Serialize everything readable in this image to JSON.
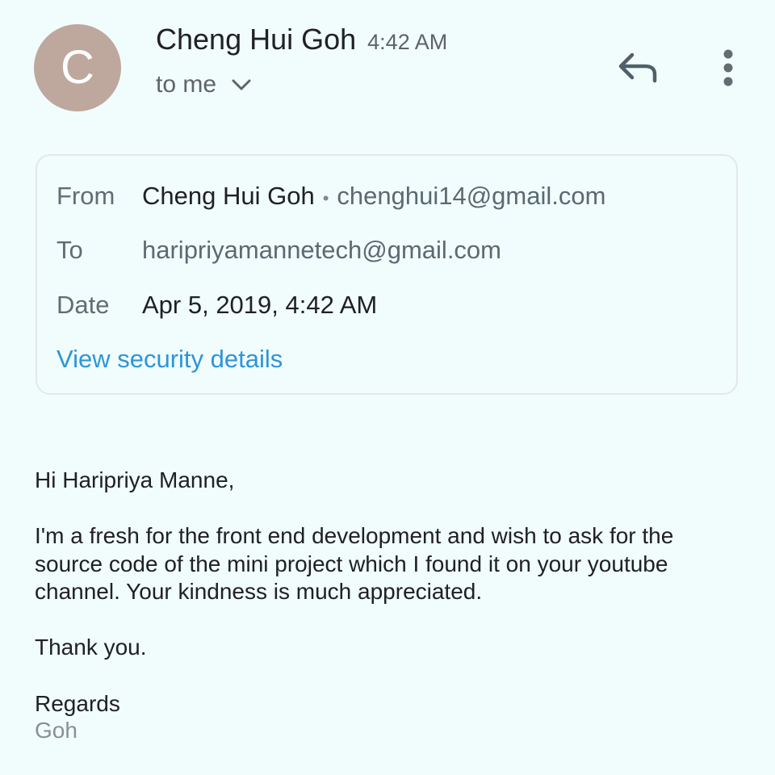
{
  "header": {
    "avatar_letter": "C",
    "sender_name": "Cheng Hui Goh",
    "time": "4:42 AM",
    "recipient_summary": "to me"
  },
  "icons": {
    "reply": "reply-icon",
    "more": "more-vert-icon",
    "expand": "chevron-down-icon"
  },
  "details": {
    "from_label": "From",
    "from_name": "Cheng Hui Goh",
    "from_separator": "•",
    "from_email": "chenghui14@gmail.com",
    "to_label": "To",
    "to_email": "haripriyamannetech@gmail.com",
    "date_label": "Date",
    "date_value": "Apr 5, 2019, 4:42 AM",
    "security_link": "View security details"
  },
  "body": {
    "greeting": "Hi Haripriya Manne,",
    "paragraph": [
      "I'm a fresh for the front end development and wish to ask for the",
      "source code of the mini project which I found it on your youtube",
      "channel. Your kindness is much appreciated."
    ],
    "thanks": "Thank you.",
    "closing": "Regards",
    "signature": "Goh"
  },
  "colors": {
    "background": "#f1fcfd",
    "avatar": "#bea89e",
    "link": "#2d95d8",
    "muted": "#5f6368"
  }
}
